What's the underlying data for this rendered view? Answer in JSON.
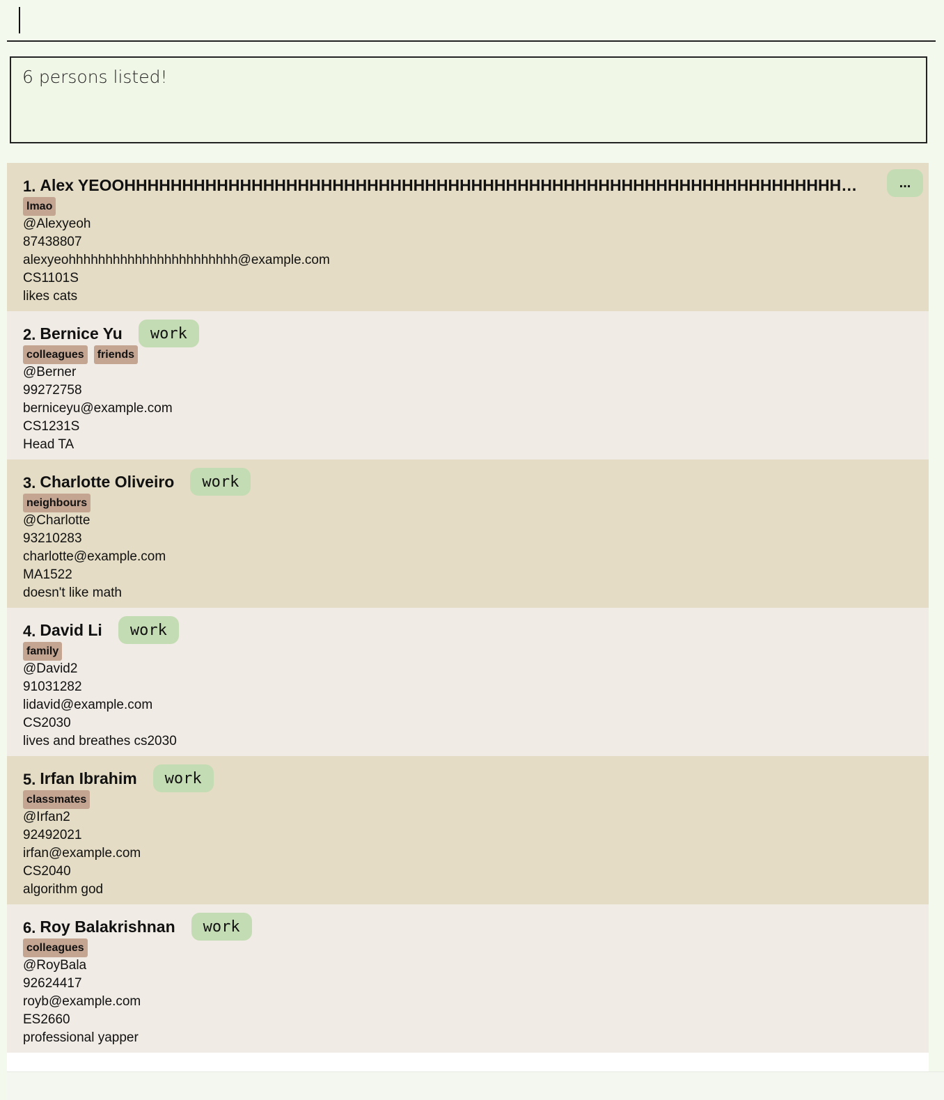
{
  "command": {
    "value": "",
    "placeholder": ""
  },
  "result": {
    "message": "6 persons listed!"
  },
  "persons": [
    {
      "index": "1.",
      "name": "Alex YEOOHHHHHHHHHHHHHHHHHHHHHHHHHHHHHHHHHHHHHHHHHHHHHHHHHHHHHHHHHHHHHHHHHHHHHHHH...",
      "role": "",
      "more": "...",
      "tags": [
        "lmao"
      ],
      "handle": "@Alexyeoh",
      "phone": "87438807",
      "email": "alexyeohhhhhhhhhhhhhhhhhhhhhhh@example.com",
      "course": "CS1101S",
      "remark": "likes cats"
    },
    {
      "index": "2.",
      "name": "Bernice Yu",
      "role": "work",
      "tags": [
        "colleagues",
        "friends"
      ],
      "handle": "@Berner",
      "phone": "99272758",
      "email": "berniceyu@example.com",
      "course": "CS1231S",
      "remark": "Head TA"
    },
    {
      "index": "3.",
      "name": "Charlotte Oliveiro",
      "role": "work",
      "tags": [
        "neighbours"
      ],
      "handle": "@Charlotte",
      "phone": "93210283",
      "email": "charlotte@example.com",
      "course": "MA1522",
      "remark": "doesn't like math"
    },
    {
      "index": "4.",
      "name": "David Li",
      "role": "work",
      "tags": [
        "family"
      ],
      "handle": "@David2",
      "phone": "91031282",
      "email": "lidavid@example.com",
      "course": "CS2030",
      "remark": "lives and breathes cs2030"
    },
    {
      "index": "5.",
      "name": "Irfan Ibrahim",
      "role": "work",
      "tags": [
        "classmates"
      ],
      "handle": "@Irfan2",
      "phone": "92492021",
      "email": "irfan@example.com",
      "course": "CS2040",
      "remark": "algorithm god"
    },
    {
      "index": "6.",
      "name": "Roy Balakrishnan",
      "role": "work",
      "tags": [
        "colleagues"
      ],
      "handle": "@RoyBala",
      "phone": "92624417",
      "email": "royb@example.com",
      "course": "ES2660",
      "remark": "professional yapper"
    }
  ],
  "colors": {
    "background": "#f4f9ee",
    "card_odd": "#e4dcc4",
    "card_even": "#f0ebe4",
    "role_badge": "#c4dcb4",
    "tag": "#c4a592"
  }
}
